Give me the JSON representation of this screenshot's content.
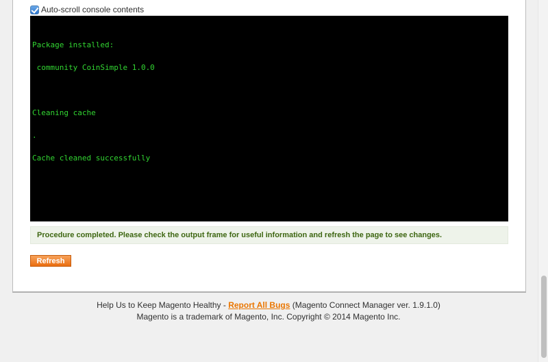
{
  "autoscroll": {
    "label": "Auto-scroll console contents",
    "checked": true
  },
  "console": {
    "lines": [
      "Package installed:",
      " community CoinSimple 1.0.0",
      "",
      "Cleaning cache",
      ".",
      "Cache cleaned successfully"
    ]
  },
  "message": {
    "text": "Procedure completed. Please check the output frame for useful information and refresh the page to see changes."
  },
  "refresh": {
    "label": "Refresh"
  },
  "footer": {
    "line1_prefix": "Help Us to Keep Magento Healthy - ",
    "bug_link": "Report All Bugs",
    "line1_suffix": " (Magento Connect Manager ver. 1.9.1.0)",
    "line2": "Magento is a trademark of Magento, Inc. Copyright © 2014 Magento Inc."
  },
  "colors": {
    "console_text": "#32d632",
    "console_bg": "#000000",
    "accent": "#ea7601",
    "success_text": "#3d6611"
  }
}
